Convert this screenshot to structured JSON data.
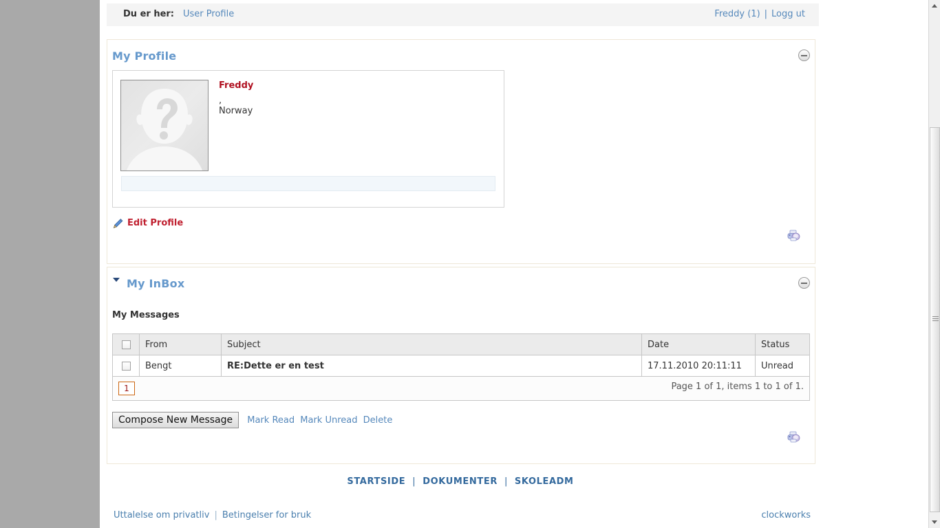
{
  "breadcrumb": {
    "label": "Du er her:",
    "current": "User Profile",
    "user": "Freddy (1)",
    "separator": "|",
    "logout": "Logg ut"
  },
  "profile_panel": {
    "title": "My Profile",
    "collapse_icon": "minus-circle-icon",
    "user": {
      "name": "Freddy",
      "line1": ",",
      "line2": "Norway",
      "avatar_icon": "unknown-person-avatar"
    },
    "edit_link": "Edit Profile",
    "edit_icon": "pencil-icon",
    "print_icon": "printer-icon"
  },
  "inbox_panel": {
    "title": "My InBox",
    "collapse_icon": "minus-circle-icon",
    "sub_heading": "My Messages",
    "table": {
      "columns": [
        "",
        "From",
        "Subject",
        "Date",
        "Status"
      ],
      "rows": [
        {
          "from": "Bengt",
          "subject": "RE:Dette er en test",
          "date": "17.11.2010 20:11:11",
          "status": "Unread"
        }
      ]
    },
    "pager": {
      "current_page": "1",
      "info": "Page 1 of 1, items 1 to 1 of 1."
    },
    "actions": {
      "compose": "Compose New Message",
      "mark_read": "Mark Read",
      "mark_unread": "Mark Unread",
      "delete": "Delete"
    },
    "print_icon": "printer-icon"
  },
  "footer": {
    "nav": [
      {
        "label": "STARTSIDE"
      },
      {
        "label": "DOKUMENTER"
      },
      {
        "label": "SKOLEADM"
      }
    ],
    "nav_separator": "|",
    "privacy": "Uttalelse om privatliv",
    "legal_separator": "|",
    "terms": "Betingelser for bruk",
    "brand": "clockworks"
  },
  "colors": {
    "page_background": "#a9a9a9",
    "content_background": "#ffffff",
    "panel_border": "#eee7d7",
    "panel_title": "#6699cc",
    "link": "#5588bb",
    "accent_red": "#b01020",
    "pager_border": "#cc6611",
    "footer_link": "#33699d"
  }
}
